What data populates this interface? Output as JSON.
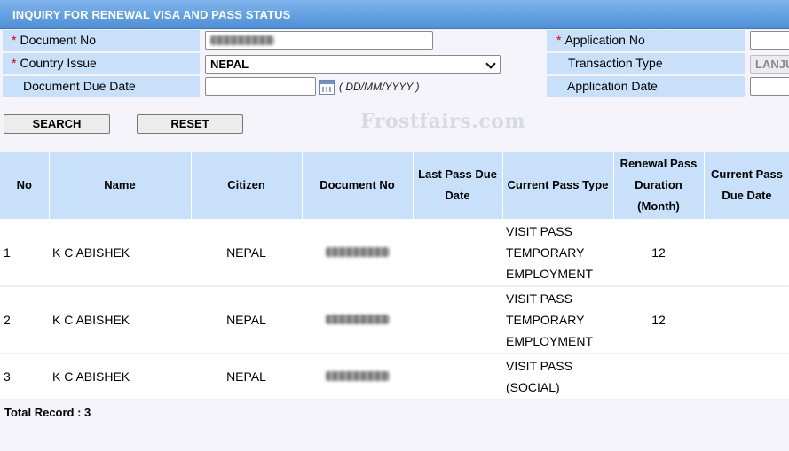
{
  "header": {
    "title": "INQUIRY FOR RENEWAL VISA AND PASS STATUS"
  },
  "form": {
    "document_no_label": "Document No",
    "country_issue_label": "Country Issue",
    "country_issue_value": "NEPAL",
    "document_due_date_label": "Document Due Date",
    "date_format_hint": "( DD/MM/YYYY )",
    "application_no_label": "Application No",
    "transaction_type_label": "Transaction Type",
    "transaction_type_value": "LANJU",
    "application_date_label": "Application Date",
    "required_mark": "*"
  },
  "buttons": {
    "search": "SEARCH",
    "reset": "RESET"
  },
  "watermark": "Frostfairs.com",
  "table": {
    "headers": {
      "no": "No",
      "name": "Name",
      "citizen": "Citizen",
      "document_no": "Document No",
      "last_pass_due_date": "Last Pass Due Date",
      "current_pass_type": "Current Pass Type",
      "renewal_pass_duration": "Renewal Pass Duration (Month)",
      "current_pass_due_date": "Current Pass Due Date"
    },
    "rows": [
      {
        "no": "1",
        "name": "K C ABISHEK",
        "citizen": "NEPAL",
        "last_pass_due_date": "",
        "current_pass_type": "VISIT PASS TEMPORARY EMPLOYMENT",
        "renewal_pass_duration": "12",
        "current_pass_due_date": ""
      },
      {
        "no": "2",
        "name": "K C ABISHEK",
        "citizen": "NEPAL",
        "last_pass_due_date": "",
        "current_pass_type": "VISIT PASS TEMPORARY EMPLOYMENT",
        "renewal_pass_duration": "12",
        "current_pass_due_date": ""
      },
      {
        "no": "3",
        "name": "K C ABISHEK",
        "citizen": "NEPAL",
        "last_pass_due_date": "",
        "current_pass_type": "VISIT PASS (SOCIAL)",
        "renewal_pass_duration": "",
        "current_pass_due_date": ""
      }
    ]
  },
  "footer": {
    "total_record": "Total Record : 3"
  },
  "colors": {
    "title_bar": "#4f8fd8",
    "label_bg": "#c8e0fa",
    "required": "#d40000"
  }
}
